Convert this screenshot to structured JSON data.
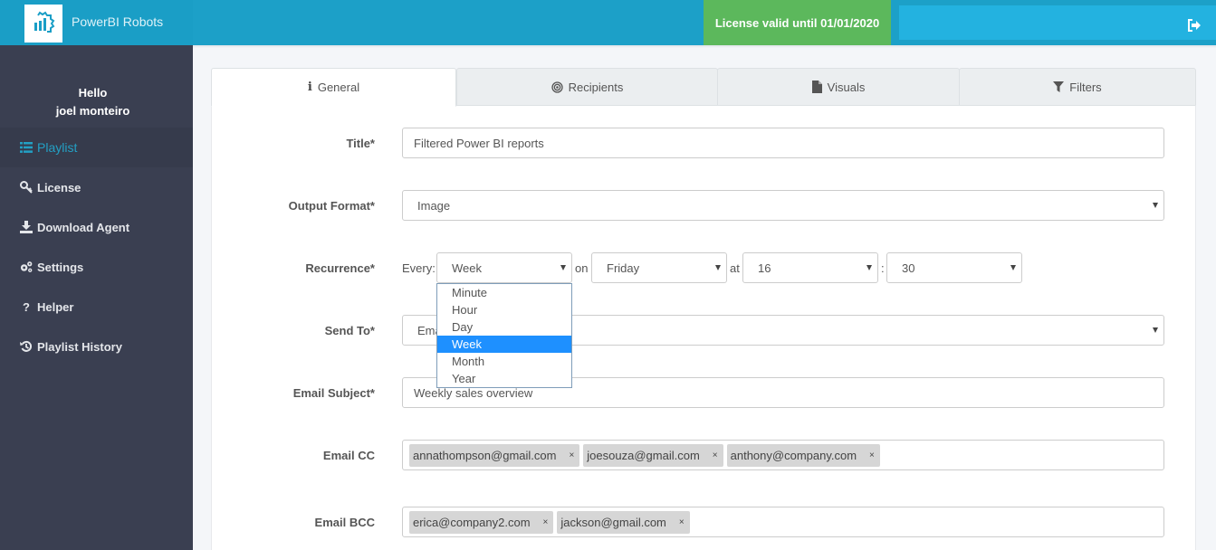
{
  "header": {
    "brand_name": "PowerBI Robots",
    "logo_icon": "gear-bar-chart-icon",
    "license_text": "License valid until 01/01/2020",
    "logout_icon": "sign-out-icon"
  },
  "sidebar": {
    "greeting": "Hello",
    "user_name": "joel monteiro",
    "items": [
      {
        "label": "Playlist",
        "icon": "list-icon",
        "active": true
      },
      {
        "label": "License",
        "icon": "key-icon",
        "active": false
      },
      {
        "label": "Download Agent",
        "icon": "download-icon",
        "active": false
      },
      {
        "label": "Settings",
        "icon": "gears-icon",
        "active": false
      },
      {
        "label": "Helper",
        "icon": "question-icon",
        "active": false
      },
      {
        "label": "Playlist History",
        "icon": "history-icon",
        "active": false
      }
    ]
  },
  "tabs": [
    {
      "label": "General",
      "icon": "info-icon",
      "active": true
    },
    {
      "label": "Recipients",
      "icon": "bullseye-icon",
      "active": false
    },
    {
      "label": "Visuals",
      "icon": "file-icon",
      "active": false
    },
    {
      "label": "Filters",
      "icon": "filter-icon",
      "active": false
    }
  ],
  "form": {
    "title": {
      "label": "Title*",
      "value": "Filtered Power BI reports"
    },
    "output_format": {
      "label": "Output Format*",
      "value": "Image"
    },
    "recurrence": {
      "label": "Recurrence*",
      "every_label": "Every:",
      "every_value": "Week",
      "on_label": "on",
      "day_value": "Friday",
      "at_label": "at",
      "hour_value": "16",
      "separator": ":",
      "minute_value": "30",
      "every_options": [
        "Minute",
        "Hour",
        "Day",
        "Week",
        "Month",
        "Year"
      ],
      "every_selected": "Week"
    },
    "send_to": {
      "label": "Send To*",
      "value": "Email"
    },
    "email_subject": {
      "label": "Email Subject*",
      "value": "Weekly sales overview"
    },
    "email_cc": {
      "label": "Email CC",
      "tags": [
        "annathompson@gmail.com",
        "joesouza@gmail.com",
        "anthony@company.com"
      ]
    },
    "email_bcc": {
      "label": "Email BCC",
      "tags": [
        "erica@company2.com",
        "jackson@gmail.com"
      ]
    },
    "tag_remove_glyph": "×"
  },
  "colors": {
    "topbar": "#1ca0c8",
    "license_badge": "#5cb85c",
    "sidebar": "#3a3f51",
    "sidebar_active_text": "#23a0c4",
    "dropdown_highlight": "#1e90ff"
  }
}
